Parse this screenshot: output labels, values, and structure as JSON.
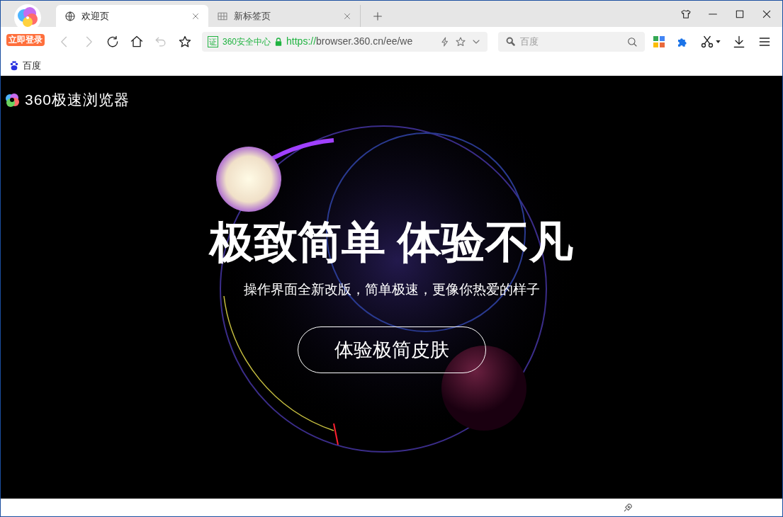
{
  "account": {
    "badge": "立即登录"
  },
  "tabs": [
    {
      "kind": "globe",
      "label": "欢迎页",
      "selected": true
    },
    {
      "kind": "grid",
      "label": "新标签页",
      "selected": false
    }
  ],
  "navigation": {
    "back_disabled": true,
    "forward_disabled": true,
    "undo_disabled": true
  },
  "address_bar": {
    "cert_label": "证",
    "site_label": "360安全中心",
    "url_scheme": "https://",
    "url_rest": "browser.360.cn/ee/we"
  },
  "search": {
    "placeholder": "百度"
  },
  "bookmarks": [
    {
      "label": "百度"
    }
  ],
  "page": {
    "logo_text": "360极速浏览器",
    "headline": "极致简单 体验不凡",
    "subtitle": "操作界面全新改版，简单极速，更像你热爱的样子",
    "cta": "体验极简皮肤"
  }
}
